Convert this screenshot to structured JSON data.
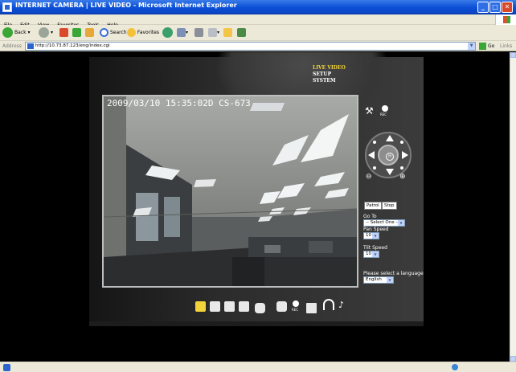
{
  "window": {
    "title": "INTERNET CAMERA | LIVE VIDEO - Microsoft Internet Explorer"
  },
  "menu": {
    "items": [
      "File",
      "Edit",
      "View",
      "Favorites",
      "Tools",
      "Help"
    ]
  },
  "toolbar": {
    "back": "Back",
    "search": "Search",
    "favorites": "Favorites"
  },
  "address": {
    "label": "Address",
    "url": "http://10.73.87.123/eng/index.cgi",
    "go": "Go",
    "links": "Links"
  },
  "nav": {
    "items": [
      "LIVE VIDEO",
      "SETUP",
      "SYSTEM"
    ],
    "active": "LIVE VIDEO"
  },
  "video": {
    "osd": "2009/03/10 15:35:02D CS-673"
  },
  "ptz": {
    "rec": "REC",
    "home": "H",
    "patrol": "Patrol",
    "stop": "Stop",
    "goto_label": "Go To",
    "goto_value": "-- Select One --",
    "pan_speed_label": "Pan Speed",
    "pan_speed_value": "10",
    "tilt_speed_label": "Tilt Speed",
    "tilt_speed_value": "10",
    "language_label": "Please select a language",
    "language_value": "English"
  },
  "video_toolbar": {
    "rec": "REC"
  },
  "colors": {
    "accent_nav": "#f3d33a",
    "panel": "#2c2c2c",
    "titlebar": "#0b4fd6"
  }
}
